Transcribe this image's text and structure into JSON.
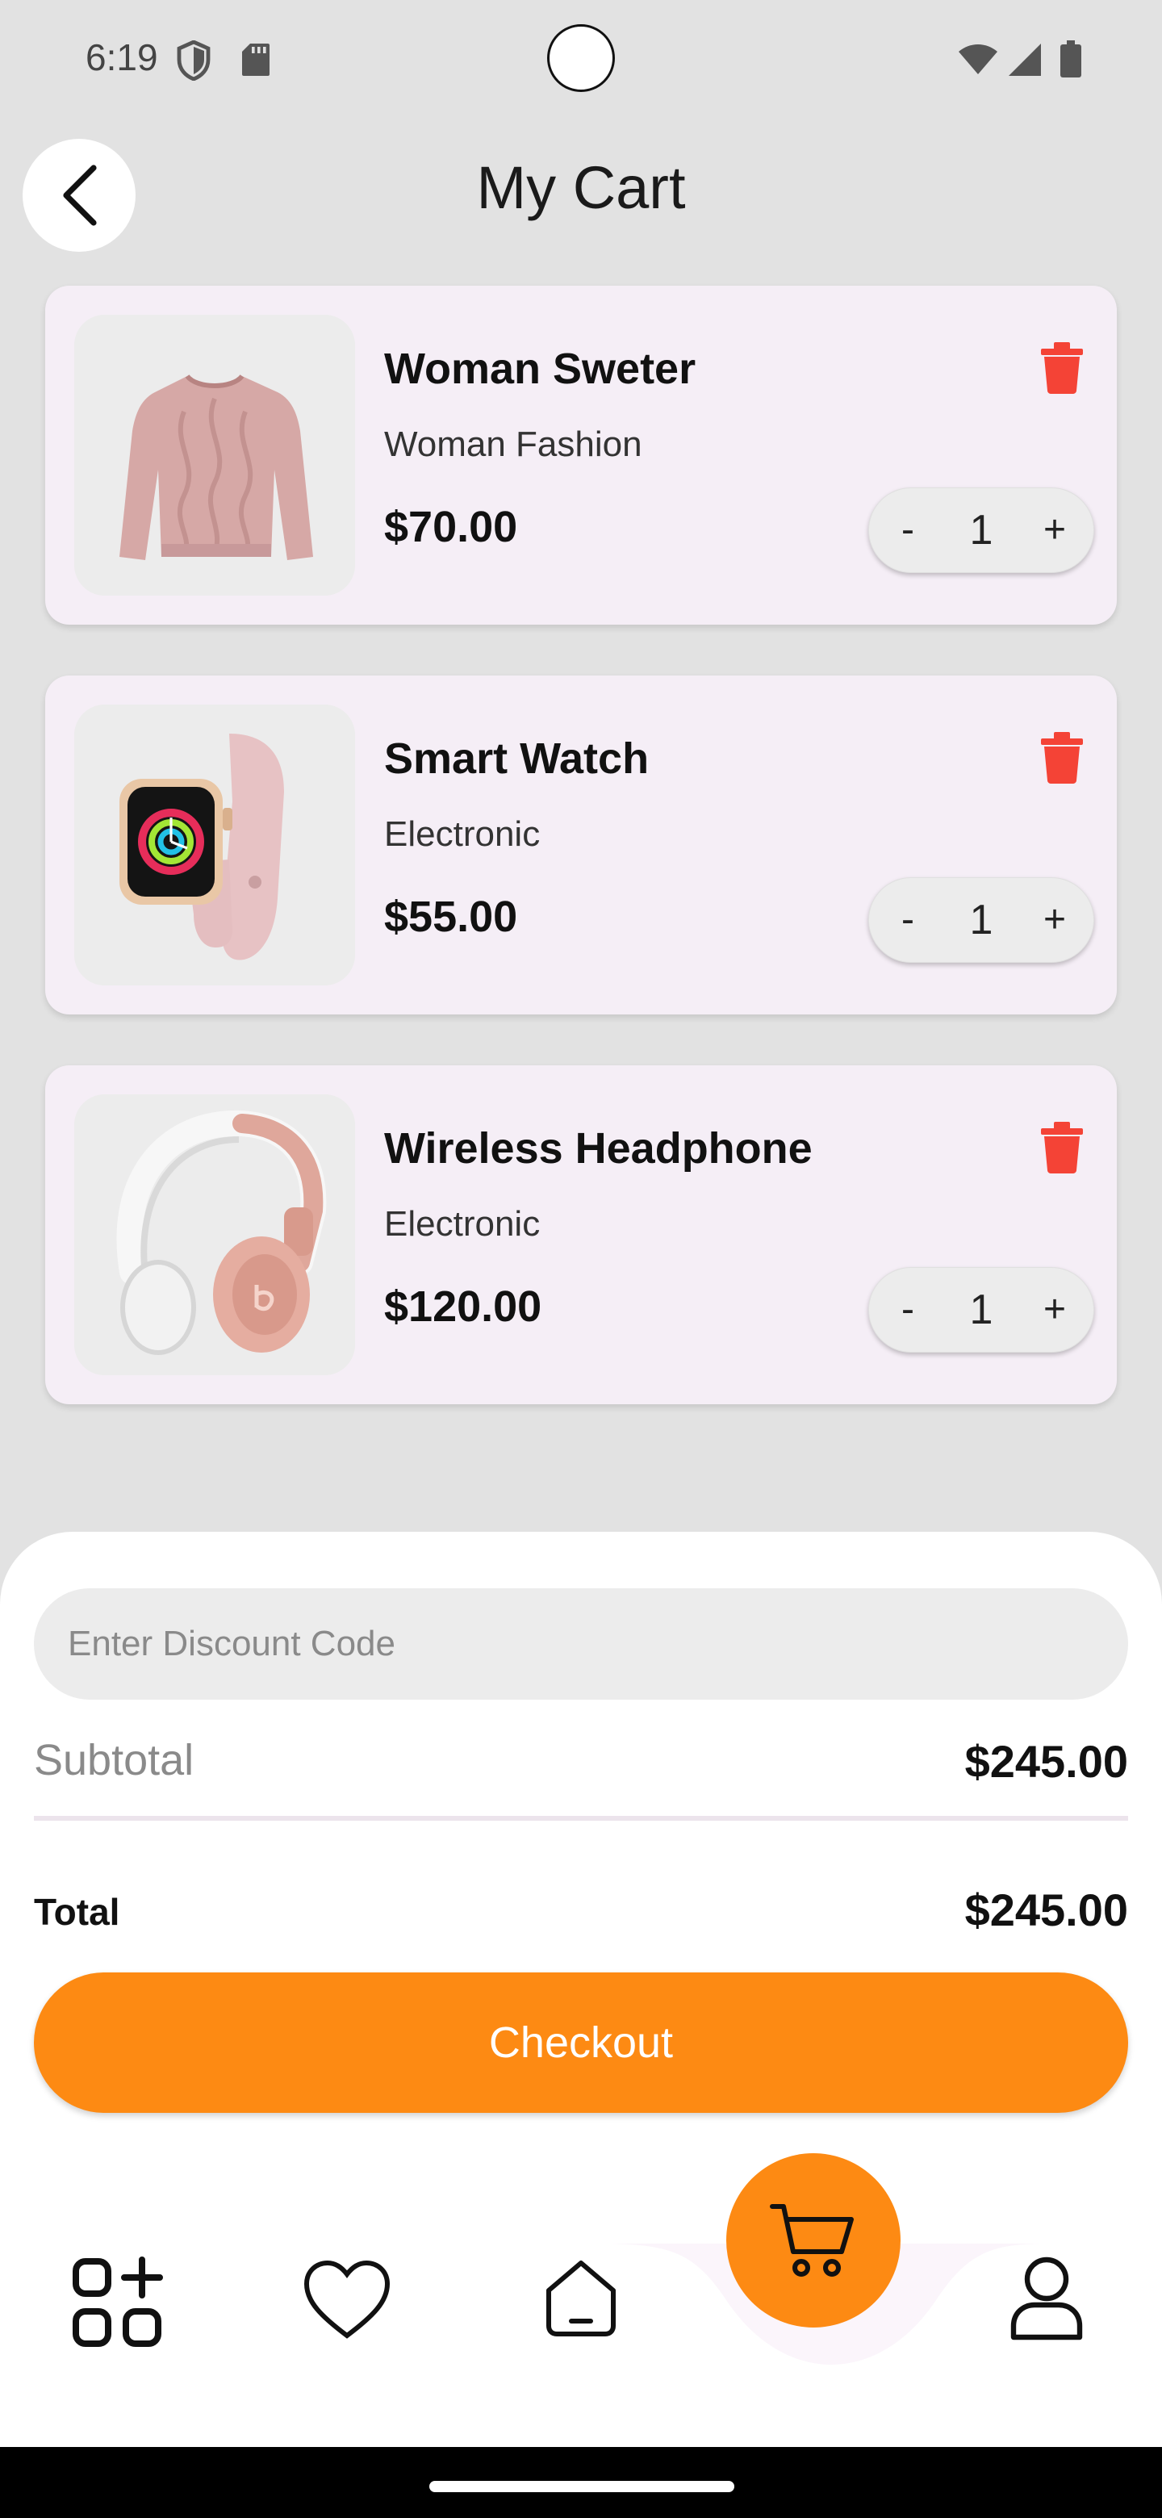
{
  "status_bar": {
    "time": "6:19"
  },
  "header": {
    "title": "My Cart"
  },
  "cart": {
    "items": [
      {
        "name": "Woman Sweter",
        "category": "Woman Fashion",
        "price": "$70.00",
        "quantity": "1",
        "image_icon": "sweater-image"
      },
      {
        "name": "Smart Watch",
        "category": "Electronic",
        "price": "$55.00",
        "quantity": "1",
        "image_icon": "smartwatch-image"
      },
      {
        "name": "Wireless Headphone",
        "category": "Electronic",
        "price": "$120.00",
        "quantity": "1",
        "image_icon": "headphone-image"
      }
    ],
    "stepper": {
      "minus_label": "-",
      "plus_label": "+"
    }
  },
  "summary": {
    "discount_placeholder": "Enter Discount Code",
    "subtotal_label": "Subtotal",
    "subtotal_value": "$245.00",
    "total_label": "Total",
    "total_value": "$245.00",
    "checkout_label": "Checkout"
  },
  "nav": {
    "items": [
      {
        "icon": "apps-icon",
        "active": false
      },
      {
        "icon": "heart-icon",
        "active": false
      },
      {
        "icon": "home-icon",
        "active": false
      },
      {
        "icon": "cart-icon",
        "active": true
      },
      {
        "icon": "profile-icon",
        "active": false
      }
    ]
  },
  "colors": {
    "accent": "#fd8a13",
    "delete": "#f44336",
    "card_background": "#f5eef6",
    "page_background": "#e2e2e2"
  }
}
